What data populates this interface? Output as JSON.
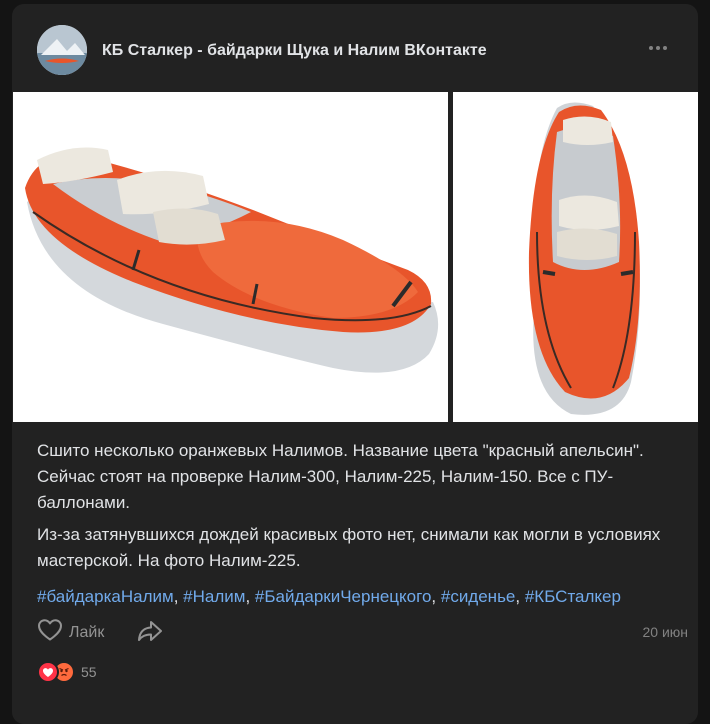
{
  "post": {
    "author": "КБ Сталкер - байдарки Щука и Налим ВКонтакте",
    "text_paragraph_1": "Сшито несколько оранжевых Налимов. Название цвета \"красный апельсин\". Сейчас стоят на проверке Налим-300, Налим-225, Налим-150. Все с ПУ-баллонами.",
    "text_paragraph_2": "Из-за затянувшихся дождей красивых фото нет, снимали как могли в условиях мастерской. На фото Налим-225.",
    "hashtags": [
      "#байдаркаНалим",
      "#Налим",
      "#БайдаркиЧернецкого",
      "#сиденье",
      "#КБСталкер"
    ],
    "hashtag_separator": ", ",
    "like_label": "Лайк",
    "date": "20 июн",
    "reactions_count": "55"
  },
  "icons": {
    "more": "more-horizontal-icon",
    "like": "heart-outline-icon",
    "share": "share-arrow-icon",
    "reaction_1": "heart-reaction-icon",
    "reaction_2": "angry-reaction-icon"
  },
  "colors": {
    "card_bg": "#222222",
    "page_bg": "#141414",
    "text": "#e1e3e6",
    "link": "#71aaeb",
    "secondary": "#828282",
    "boat_orange": "#e8552b"
  }
}
